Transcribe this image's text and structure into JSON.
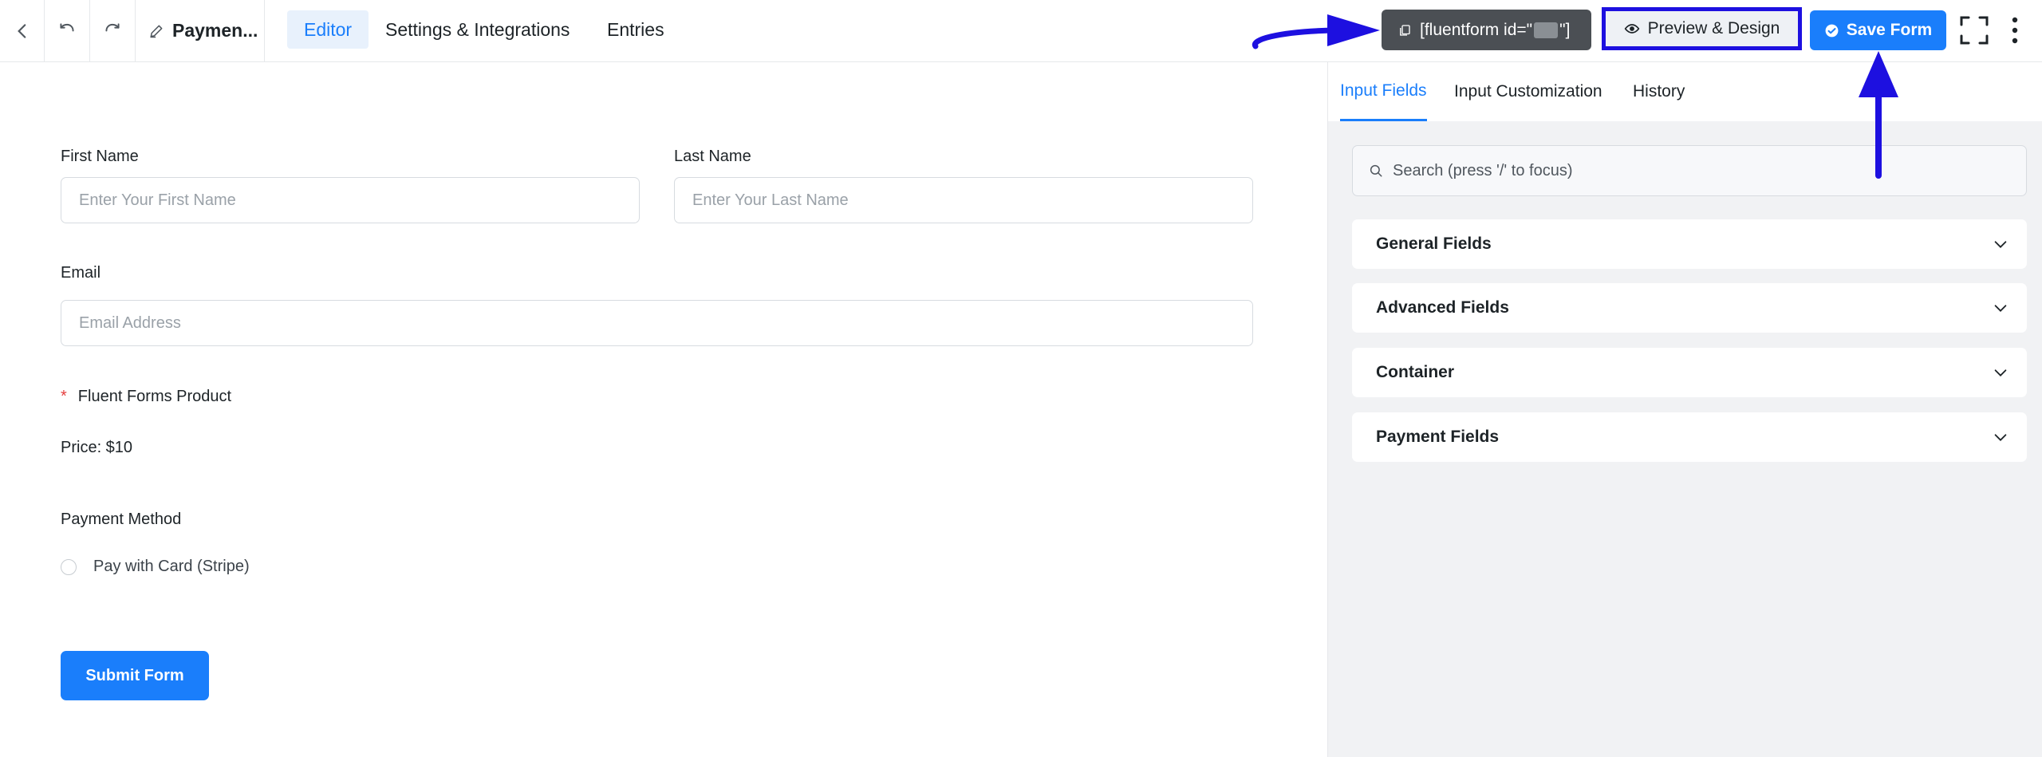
{
  "topbar": {
    "title": "Paymen...",
    "tabs": [
      {
        "label": "Editor",
        "active": true
      },
      {
        "label": "Settings & Integrations",
        "active": false
      },
      {
        "label": "Entries",
        "active": false
      }
    ],
    "shortcode_prefix": "[fluentform id=\"",
    "shortcode_suffix": "\"]",
    "preview_label": "Preview & Design",
    "save_label": "Save Form"
  },
  "form": {
    "first_name": {
      "label": "First Name",
      "placeholder": "Enter Your First Name"
    },
    "last_name": {
      "label": "Last Name",
      "placeholder": "Enter Your Last Name"
    },
    "email": {
      "label": "Email",
      "placeholder": "Email Address"
    },
    "product": {
      "required_mark": "*",
      "label": "Fluent Forms Product",
      "price": "Price: $10"
    },
    "payment_method": {
      "label": "Payment Method",
      "option": "Pay with Card (Stripe)"
    },
    "submit_label": "Submit Form"
  },
  "panel": {
    "tabs": [
      {
        "label": "Input Fields",
        "active": true
      },
      {
        "label": "Input Customization",
        "active": false
      },
      {
        "label": "History",
        "active": false
      }
    ],
    "search_placeholder": "Search (press '/' to focus)",
    "sections": [
      "General Fields",
      "Advanced Fields",
      "Container",
      "Payment Fields"
    ]
  },
  "colors": {
    "accent": "#1a7efb",
    "annotation": "#1d10e0",
    "shortcode_bg": "#4b4f54",
    "required": "#e53e3e"
  }
}
